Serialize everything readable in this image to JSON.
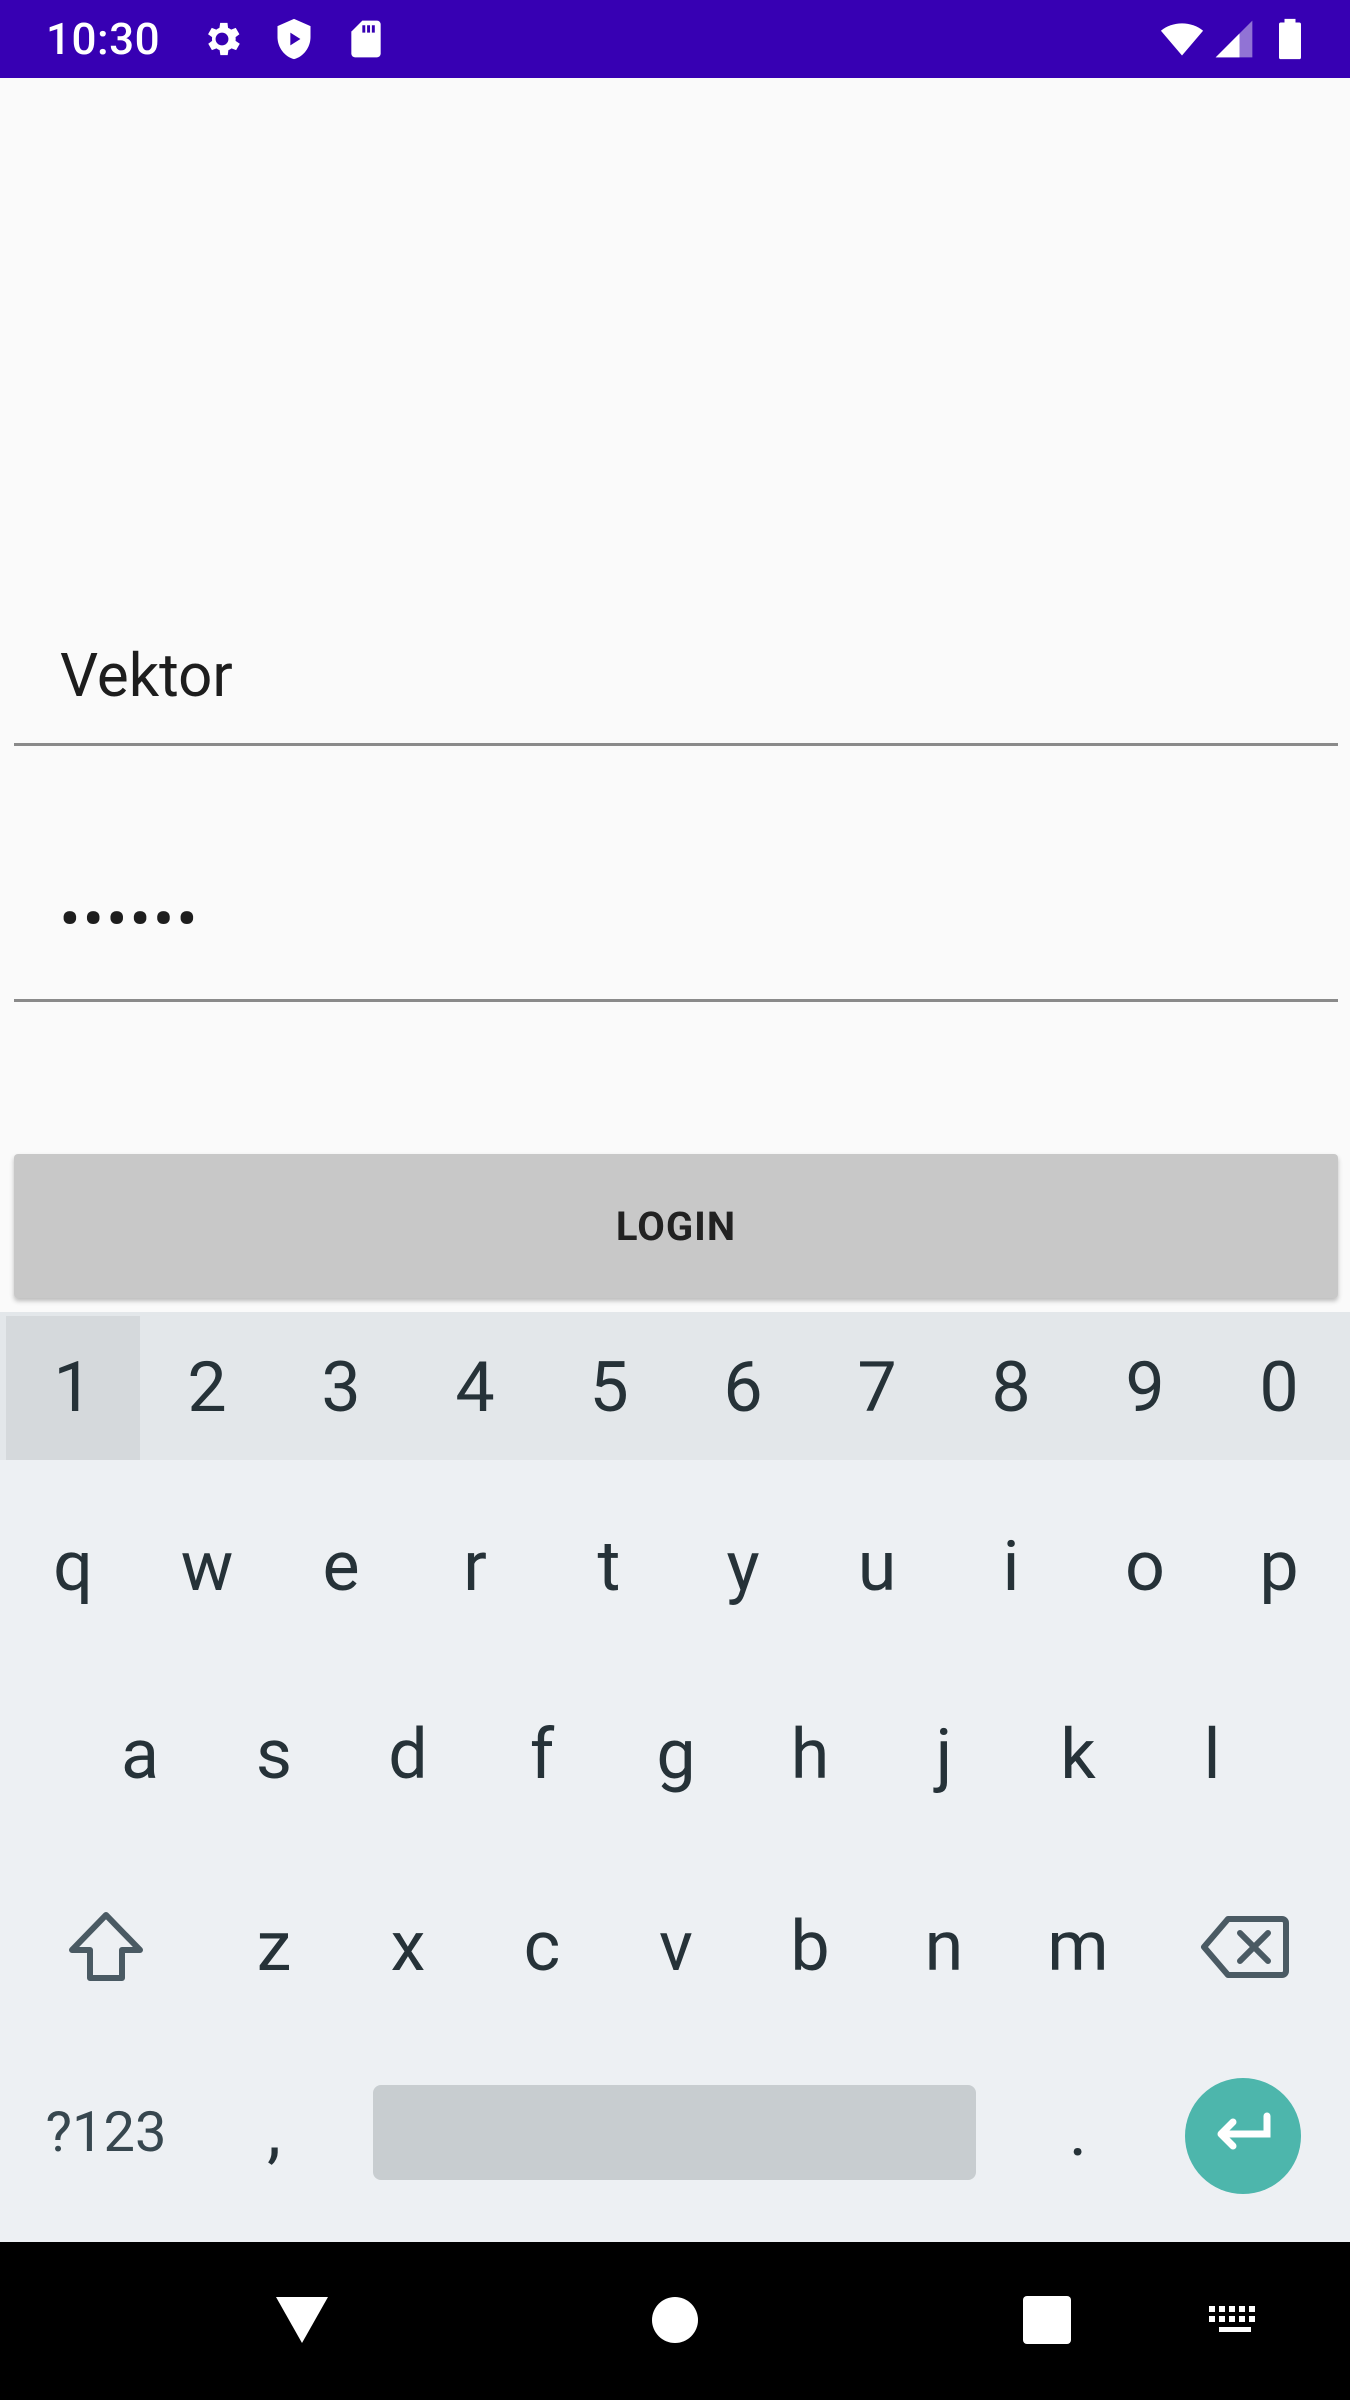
{
  "status_bar": {
    "time": "10:30",
    "left_icons": [
      "gear-icon",
      "shield-icon",
      "sd-card-icon"
    ],
    "right_icons": [
      "wifi-icon",
      "signal-icon",
      "battery-icon"
    ],
    "background": "#3700b3"
  },
  "form": {
    "username_value": "Vektor",
    "password_value": "••••••",
    "login_label": "LOGIN"
  },
  "keyboard": {
    "number_row": [
      "1",
      "2",
      "3",
      "4",
      "5",
      "6",
      "7",
      "8",
      "9",
      "0"
    ],
    "row1": [
      "q",
      "w",
      "e",
      "r",
      "t",
      "y",
      "u",
      "i",
      "o",
      "p"
    ],
    "row2": [
      "a",
      "s",
      "d",
      "f",
      "g",
      "h",
      "j",
      "k",
      "l"
    ],
    "row3": [
      "z",
      "x",
      "c",
      "v",
      "b",
      "n",
      "m"
    ],
    "symbols_label": "?123",
    "comma": ",",
    "period": ".",
    "enter_color": "#4db6ac"
  },
  "nav_bar": {
    "buttons": [
      "back-icon",
      "home-icon",
      "recents-icon",
      "keyboard-icon"
    ]
  }
}
